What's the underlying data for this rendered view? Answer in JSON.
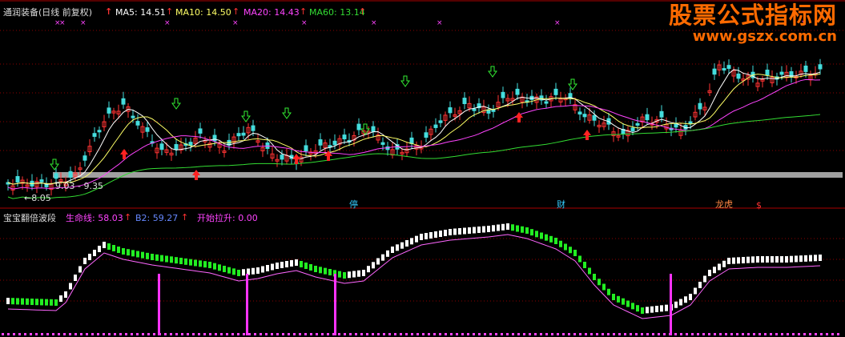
{
  "top_panel": {
    "stock_title": "通润装备(日线 前复权)",
    "ma_legend": [
      {
        "text": "MA5: 14.51",
        "color": "#ffffff"
      },
      {
        "text": "MA10: 14.50",
        "color": "#ffff66"
      },
      {
        "text": "MA20: 14.43",
        "color": "#ff44ff"
      },
      {
        "text": "MA60: 13.14",
        "color": "#33dd33"
      }
    ],
    "low_price_label": "8.05",
    "band_label": "9.03 - 9.35",
    "event_tags": [
      {
        "text": "停",
        "color": "#33ccff"
      },
      {
        "text": "财",
        "color": "#33ccff"
      },
      {
        "text": "龙虎",
        "color": "#ff8844"
      },
      {
        "text": "$",
        "color": "#ff3333"
      }
    ]
  },
  "bottom_panel": {
    "indicator_title": "宝宝翻倍波段",
    "legend": [
      {
        "text": "生命线: 58.03",
        "color": "#ff44ff"
      },
      {
        "text": "B2: 59.27",
        "color": "#6688ff"
      },
      {
        "text": "开始拉升: 0.00",
        "color": "#ff44ff"
      }
    ]
  },
  "watermark": {
    "title": "股票公式指标网",
    "url": "www.gszx.com.cn"
  },
  "colors": {
    "up": "#ff3333",
    "down": "#44dddd",
    "ma5": "#ffffff",
    "ma10": "#ffff66",
    "ma20": "#ff44ff",
    "ma60": "#33dd33",
    "grid": "#8b0000",
    "band": "#a0a0a0",
    "bar_up": "#ffffff",
    "bar_down": "#22ee22"
  }
}
